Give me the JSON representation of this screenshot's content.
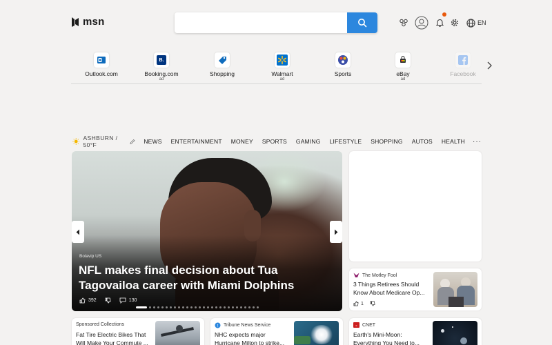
{
  "header": {
    "logo_text": "msn",
    "search_placeholder": "",
    "language": "EN"
  },
  "quick_links": [
    {
      "label": "Outlook.com",
      "ad": "",
      "icon": "outlook-icon",
      "color": "#0f6cbd"
    },
    {
      "label": "Booking.com",
      "ad": "ad",
      "icon": "booking-icon",
      "color": "#003580",
      "glyph": "B."
    },
    {
      "label": "Shopping",
      "ad": "",
      "icon": "shopping-tag-icon",
      "color": "#0f6cbd"
    },
    {
      "label": "Walmart",
      "ad": "ad",
      "icon": "walmart-icon",
      "color": "#0071ce"
    },
    {
      "label": "Sports",
      "ad": "",
      "icon": "sports-icon",
      "color": "#3b4ea8"
    },
    {
      "label": "eBay",
      "ad": "ad",
      "icon": "ebay-icon",
      "color": "#333333"
    },
    {
      "label": "Facebook",
      "ad": "",
      "icon": "facebook-icon",
      "color": "#1877f2"
    }
  ],
  "nav": {
    "weather_icon": "sun-icon",
    "location_weather": "ASHBURN / 50°F",
    "items": [
      "NEWS",
      "ENTERTAINMENT",
      "MONEY",
      "SPORTS",
      "GAMING",
      "LIFESTYLE",
      "SHOPPING",
      "AUTOS",
      "HEALTH"
    ],
    "more": "···"
  },
  "hero": {
    "source": "Bolavip US",
    "title": "NFL makes final decision about Tua Tagovailoa career with Miami Dolphins",
    "likes": "392",
    "comments": "130",
    "slide_count": 28,
    "active_slide": 1
  },
  "cards": [
    {
      "source": "The Motley Fool",
      "source_color": "#8e1d6b",
      "title": "3 Things Retirees Should Know About Medicare Op...",
      "likes": "1"
    },
    {
      "source": "Sponsored Collections",
      "title": "Fat Tire Electric Bikes That Will Make Your Commute ..."
    },
    {
      "source": "Tribune News Service",
      "source_color": "#2c87de",
      "title": "NHC expects major Hurricane Milton to strike..."
    },
    {
      "source": "CNET",
      "source_color": "#cc1f1f",
      "title": "Earth's Mini-Moon: Everything You Need to..."
    }
  ],
  "colors": {
    "accent": "#2c87de",
    "background": "#f3f2f1",
    "notification": "#e8590c"
  }
}
